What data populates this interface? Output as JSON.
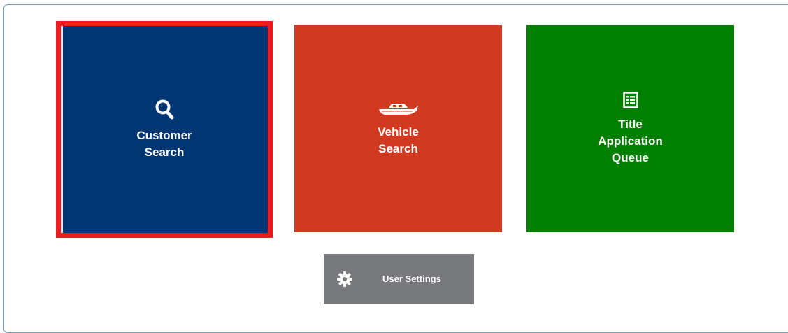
{
  "tiles": {
    "customer_search": {
      "label": "Customer Search",
      "icon": "search-icon",
      "color": "#003671",
      "highlight_color": "#ee1c1c"
    },
    "vehicle_search": {
      "label": "Vehicle Search",
      "icon": "boat-icon",
      "color": "#d03a21"
    },
    "title_application_queue": {
      "label": "Title Application Queue",
      "icon": "list-document-icon",
      "color": "#007f00"
    }
  },
  "user_settings": {
    "label": "User Settings",
    "icon": "gear-icon",
    "color": "#77797c"
  }
}
